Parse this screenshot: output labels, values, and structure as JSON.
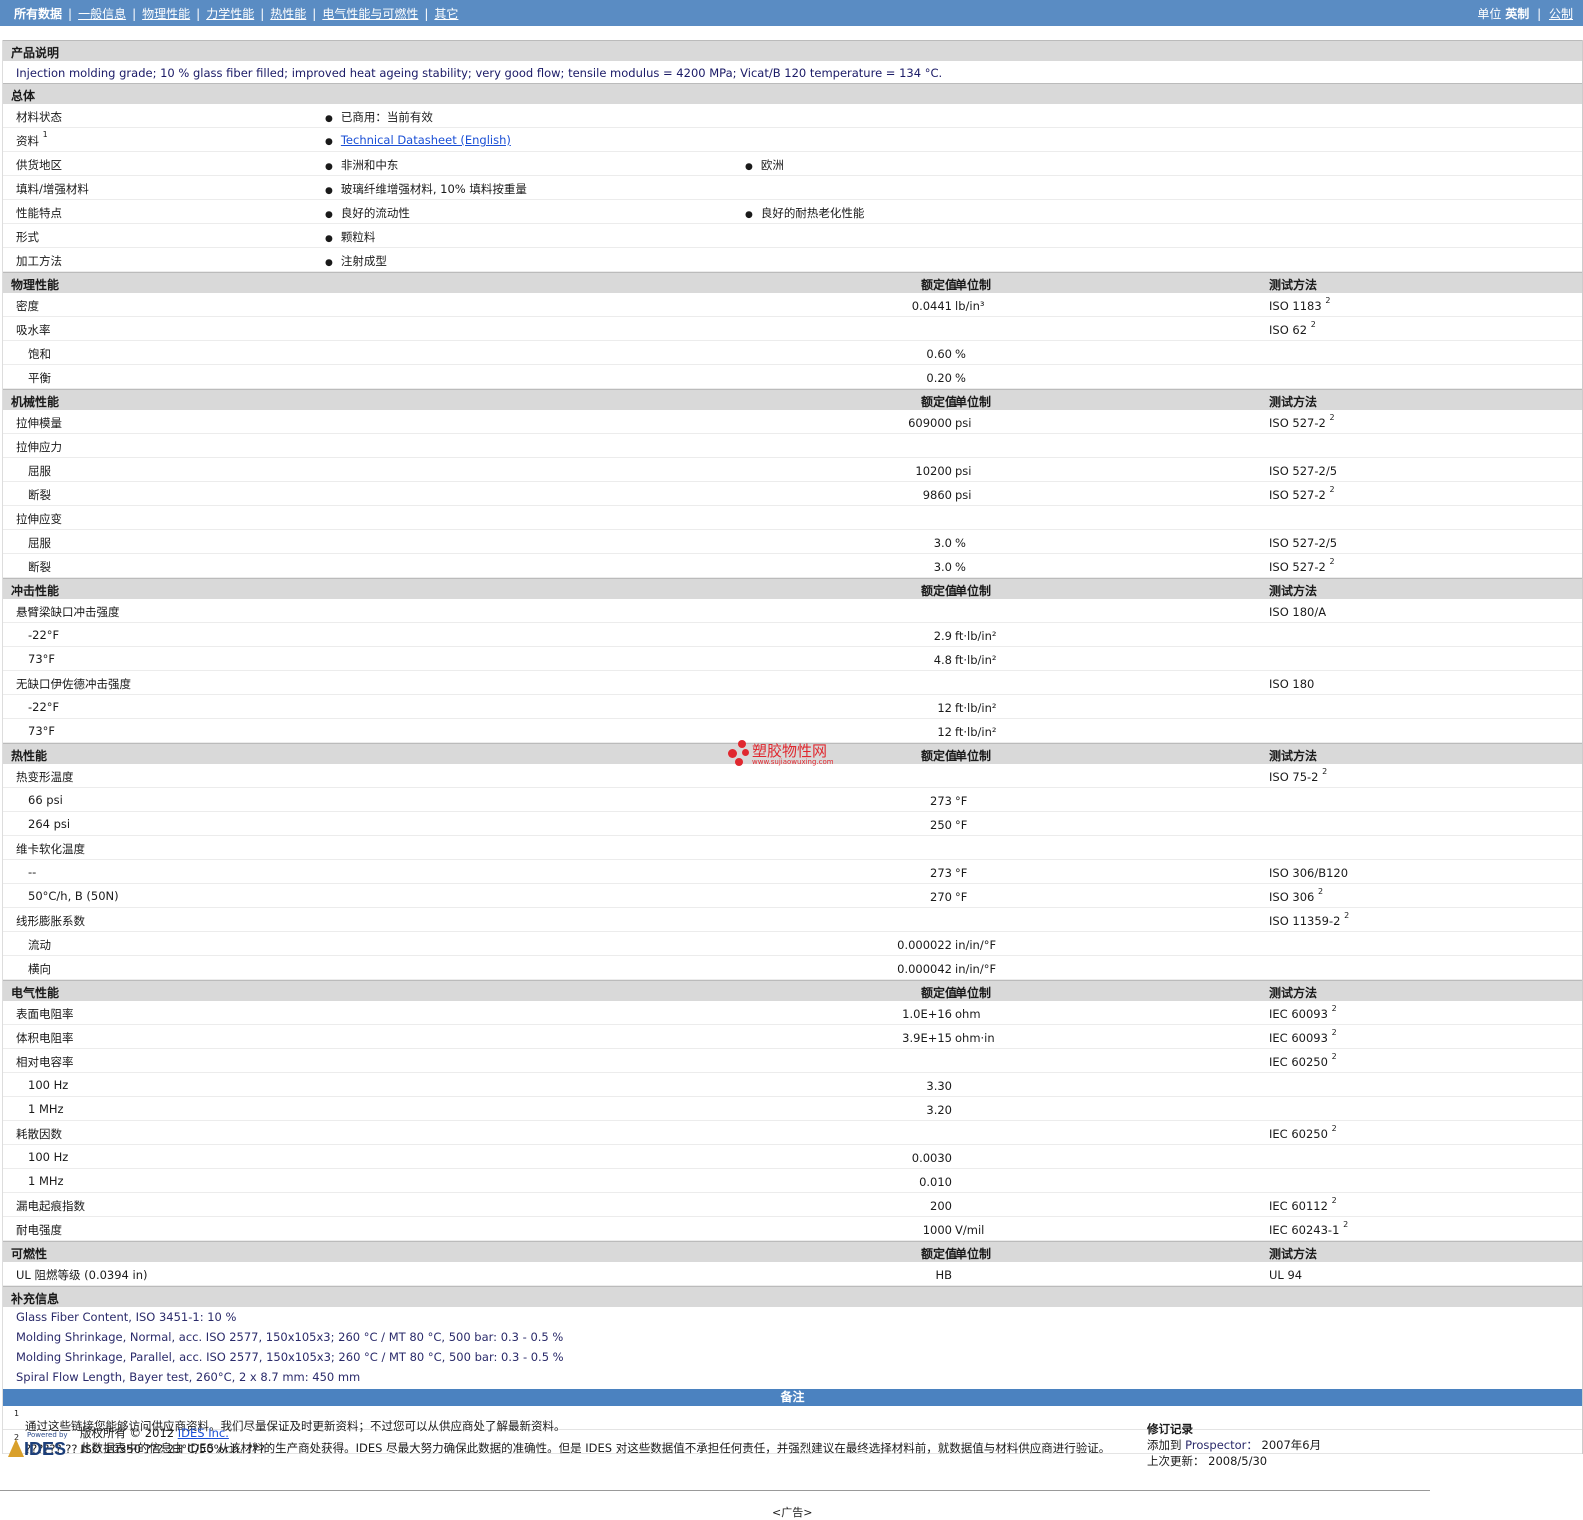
{
  "nav": {
    "items": [
      {
        "label": "所有数据",
        "selected": true
      },
      {
        "label": "一般信息",
        "selected": false
      },
      {
        "label": "物理性能",
        "selected": false
      },
      {
        "label": "力学性能",
        "selected": false
      },
      {
        "label": "热性能",
        "selected": false
      },
      {
        "label": "电气性能与可燃性",
        "selected": false
      },
      {
        "label": "其它",
        "selected": false
      }
    ],
    "units_label": "单位",
    "unit_imperial": "英制",
    "unit_metric": "公制"
  },
  "description": {
    "title": "产品说明",
    "text": "Injection molding grade; 10 % glass fiber filled; improved heat ageing stability; very good flow; tensile modulus = 4200 MPa; Vicat/B 120 temperature = 134 °C."
  },
  "general": {
    "title": "总体",
    "rows": [
      {
        "label": "材料状态",
        "sup": "",
        "c1": "已商用：当前有效",
        "c2": "",
        "link": false
      },
      {
        "label": "资料",
        "sup": "1",
        "c1": "Technical Datasheet (English)",
        "c2": "",
        "link": true
      },
      {
        "label": "供货地区",
        "sup": "",
        "c1": "非洲和中东",
        "c2": "欧洲",
        "link": false
      },
      {
        "label": "填料/增强材料",
        "sup": "",
        "c1": "玻璃纤维增强材料, 10% 填料按重量",
        "c2": "",
        "link": false
      },
      {
        "label": "性能特点",
        "sup": "",
        "c1": "良好的流动性",
        "c2": "良好的耐热老化性能",
        "link": false
      },
      {
        "label": "形式",
        "sup": "",
        "c1": "颗粒料",
        "c2": "",
        "link": false
      },
      {
        "label": "加工方法",
        "sup": "",
        "c1": "注射成型",
        "c2": "",
        "link": false
      }
    ]
  },
  "headers": {
    "value": "额定值",
    "unit": "单位制",
    "method": "测试方法"
  },
  "sections": [
    {
      "title": "物理性能",
      "rows": [
        {
          "label": "密度",
          "sub": false,
          "value": "0.0441",
          "unit": "lb/in³",
          "method": "ISO 1183",
          "sup": "2"
        },
        {
          "label": "吸水率",
          "sub": false,
          "value": "",
          "unit": "",
          "method": "ISO 62",
          "sup": "2"
        },
        {
          "label": "饱和",
          "sub": true,
          "value": "0.60",
          "unit": "%",
          "method": "",
          "sup": ""
        },
        {
          "label": "平衡",
          "sub": true,
          "value": "0.20",
          "unit": "%",
          "method": "",
          "sup": ""
        }
      ]
    },
    {
      "title": "机械性能",
      "rows": [
        {
          "label": "拉伸模量",
          "sub": false,
          "value": "609000",
          "unit": "psi",
          "method": "ISO 527-2",
          "sup": "2"
        },
        {
          "label": "拉伸应力",
          "sub": false,
          "value": "",
          "unit": "",
          "method": "",
          "sup": ""
        },
        {
          "label": "屈服",
          "sub": true,
          "value": "10200",
          "unit": "psi",
          "method": "ISO 527-2/5",
          "sup": ""
        },
        {
          "label": "断裂",
          "sub": true,
          "value": "9860",
          "unit": "psi",
          "method": "ISO 527-2",
          "sup": "2"
        },
        {
          "label": "拉伸应变",
          "sub": false,
          "value": "",
          "unit": "",
          "method": "",
          "sup": ""
        },
        {
          "label": "屈服",
          "sub": true,
          "value": "3.0",
          "unit": "%",
          "method": "ISO 527-2/5",
          "sup": ""
        },
        {
          "label": "断裂",
          "sub": true,
          "value": "3.0",
          "unit": "%",
          "method": "ISO 527-2",
          "sup": "2"
        }
      ]
    },
    {
      "title": "冲击性能",
      "rows": [
        {
          "label": "悬臂梁缺口冲击强度",
          "sub": false,
          "value": "",
          "unit": "",
          "method": "ISO 180/A",
          "sup": ""
        },
        {
          "label": "-22°F",
          "sub": true,
          "value": "2.9",
          "unit": "ft·lb/in²",
          "method": "",
          "sup": ""
        },
        {
          "label": "73°F",
          "sub": true,
          "value": "4.8",
          "unit": "ft·lb/in²",
          "method": "",
          "sup": ""
        },
        {
          "label": "无缺口伊佐德冲击强度",
          "sub": false,
          "value": "",
          "unit": "",
          "method": "ISO 180",
          "sup": ""
        },
        {
          "label": "-22°F",
          "sub": true,
          "value": "12",
          "unit": "ft·lb/in²",
          "method": "",
          "sup": ""
        },
        {
          "label": "73°F",
          "sub": true,
          "value": "12",
          "unit": "ft·lb/in²",
          "method": "",
          "sup": ""
        }
      ]
    },
    {
      "title": "热性能",
      "rows": [
        {
          "label": "热变形温度",
          "sub": false,
          "value": "",
          "unit": "",
          "method": "ISO 75-2",
          "sup": "2"
        },
        {
          "label": "66 psi",
          "sub": true,
          "value": "273",
          "unit": "°F",
          "method": "",
          "sup": ""
        },
        {
          "label": "264 psi",
          "sub": true,
          "value": "250",
          "unit": "°F",
          "method": "",
          "sup": ""
        },
        {
          "label": "维卡软化温度",
          "sub": false,
          "value": "",
          "unit": "",
          "method": "",
          "sup": ""
        },
        {
          "label": "--",
          "sub": true,
          "value": "273",
          "unit": "°F",
          "method": "ISO 306/B120",
          "sup": ""
        },
        {
          "label": "50°C/h, B (50N)",
          "sub": true,
          "value": "270",
          "unit": "°F",
          "method": "ISO 306",
          "sup": "2"
        },
        {
          "label": "线形膨胀系数",
          "sub": false,
          "value": "",
          "unit": "",
          "method": "ISO 11359-2",
          "sup": "2"
        },
        {
          "label": "流动",
          "sub": true,
          "value": "0.000022",
          "unit": "in/in/°F",
          "method": "",
          "sup": ""
        },
        {
          "label": "横向",
          "sub": true,
          "value": "0.000042",
          "unit": "in/in/°F",
          "method": "",
          "sup": ""
        }
      ]
    },
    {
      "title": "电气性能",
      "rows": [
        {
          "label": "表面电阻率",
          "sub": false,
          "value": "1.0E+16",
          "unit": "ohm",
          "method": "IEC 60093",
          "sup": "2"
        },
        {
          "label": "体积电阻率",
          "sub": false,
          "value": "3.9E+15",
          "unit": "ohm·in",
          "method": "IEC 60093",
          "sup": "2"
        },
        {
          "label": "相对电容率",
          "sub": false,
          "value": "",
          "unit": "",
          "method": "IEC 60250",
          "sup": "2"
        },
        {
          "label": "100 Hz",
          "sub": true,
          "value": "3.30",
          "unit": "",
          "method": "",
          "sup": ""
        },
        {
          "label": "1 MHz",
          "sub": true,
          "value": "3.20",
          "unit": "",
          "method": "",
          "sup": ""
        },
        {
          "label": "耗散因数",
          "sub": false,
          "value": "",
          "unit": "",
          "method": "IEC 60250",
          "sup": "2"
        },
        {
          "label": "100 Hz",
          "sub": true,
          "value": "0.0030",
          "unit": "",
          "method": "",
          "sup": ""
        },
        {
          "label": "1 MHz",
          "sub": true,
          "value": "0.010",
          "unit": "",
          "method": "",
          "sup": ""
        },
        {
          "label": "漏电起痕指数",
          "sub": false,
          "value": "200",
          "unit": "",
          "method": "IEC 60112",
          "sup": "2"
        },
        {
          "label": "耐电强度",
          "sub": false,
          "value": "1000",
          "unit": "V/mil",
          "method": "IEC 60243-1",
          "sup": "2"
        }
      ]
    },
    {
      "title": "可燃性",
      "rows": [
        {
          "label": "UL 阻燃等级 (0.0394 in)",
          "sub": false,
          "value": "HB",
          "unit": "",
          "method": "UL 94",
          "sup": ""
        }
      ]
    }
  ],
  "supplement": {
    "title": "补充信息",
    "lines": [
      "Glass Fiber Content, ISO 3451-1: 10 %",
      "Molding Shrinkage, Normal, acc. ISO 2577, 150x105x3; 260 °C / MT 80 °C, 500 bar: 0.3 - 0.5 %",
      "Molding Shrinkage, Parallel, acc. ISO 2577, 150x105x3; 260 °C / MT 80 °C, 500 bar: 0.3 - 0.5 %",
      "Spiral Flow Length, Bayer test, 260°C, 2 x 8.7 mm: 450 mm"
    ]
  },
  "notes": {
    "title": "备注",
    "items": [
      {
        "sup": "1",
        "text": "通过这些链接您能够访问供应商资料。我们尽量保证及时更新资料；不过您可以从供应商处了解最新资料。"
      },
      {
        "sup": "2",
        "text": "??????,?? ISO 10350 ??? 23°C/50%r.h. ???"
      }
    ]
  },
  "footer": {
    "powered_by": "Powered by",
    "logo_text": "IDES",
    "copyright_prefix": "版权所有 © 2012 ",
    "copyright_link": "IDES Inc.",
    "disclaimer": "此数据表中的信息由 IDES 从该材料的生产商处获得。IDES 尽最大努力确保此数据的准确性。但是 IDES 对这些数据值不承担任何责任，并强烈建议在最终选择材料前，就数据值与材料供应商进行验证。",
    "revision_title": "修订记录",
    "added_label": "添加到",
    "added_source": "Prospector：",
    "added_date": "2007年6月",
    "updated_label": "上次更新：",
    "updated_date": "2008/5/30",
    "ad": "<广告>"
  },
  "watermark": {
    "title": "塑胶物性网",
    "url": "www.sujiaowuxing.com"
  },
  "colors": {
    "topbar": "#5a8cc3",
    "section": "#d9d9d9",
    "notebar": "#4b82c0",
    "desc_text": "#1a1a66"
  }
}
